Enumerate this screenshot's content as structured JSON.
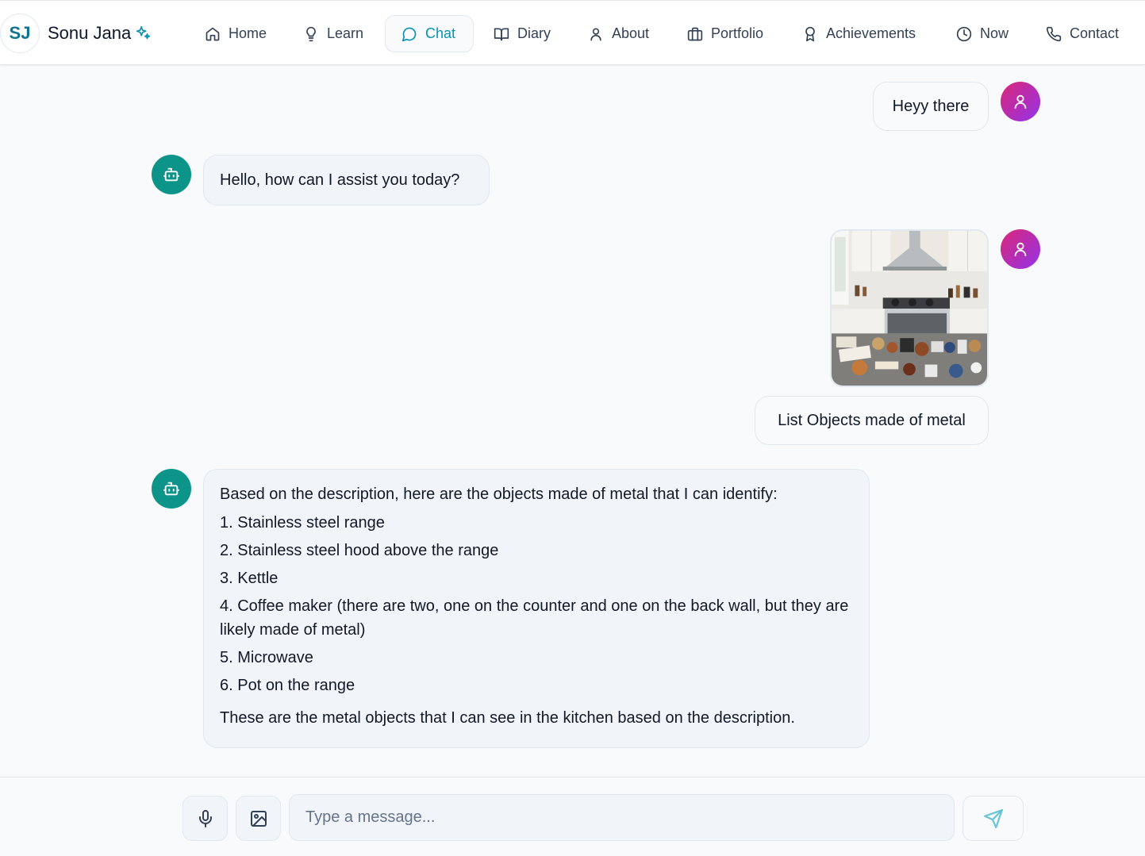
{
  "brand": {
    "initials": "SJ",
    "name": "Sonu Jana"
  },
  "nav": [
    {
      "label": "Home",
      "icon": "home-icon"
    },
    {
      "label": "Learn",
      "icon": "lightbulb-icon"
    },
    {
      "label": "Chat",
      "icon": "chat-icon",
      "active": true
    },
    {
      "label": "Diary",
      "icon": "book-icon"
    },
    {
      "label": "About",
      "icon": "user-icon"
    },
    {
      "label": "Portfolio",
      "icon": "briefcase-icon"
    },
    {
      "label": "Achievements",
      "icon": "award-icon"
    },
    {
      "label": "Now",
      "icon": "clock-icon"
    },
    {
      "label": "Contact",
      "icon": "phone-icon"
    }
  ],
  "messages": {
    "user_1": "Heyy there",
    "bot_1": "Hello, how can I assist you today?",
    "user_2_image": "kitchen-photo",
    "user_2_text": "List Objects made of metal",
    "bot_2": {
      "intro": "Based on the description, here are the objects made of metal that I can identify:",
      "items": [
        "1. Stainless steel range",
        "2. Stainless steel hood above the range",
        "3. Kettle",
        "4. Coffee maker (there are two, one on the counter and one on the back wall, but they are likely made of metal)",
        "5. Microwave",
        "6. Pot on the range"
      ],
      "outro": "These are the metal objects that I can see in the kitchen based on the description."
    }
  },
  "composer": {
    "placeholder": "Type a message...",
    "value": ""
  },
  "colors": {
    "accent": "#0891b2",
    "bot_avatar": "#0d9488",
    "user_avatar_from": "#db2777",
    "user_avatar_to": "#9333ea"
  }
}
